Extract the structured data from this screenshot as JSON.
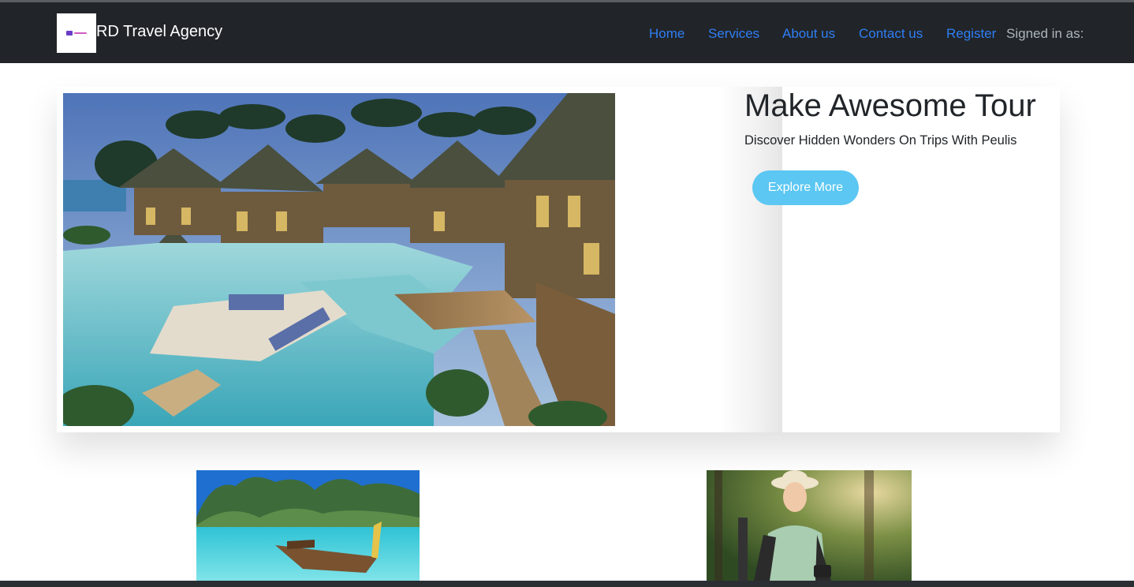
{
  "navbar": {
    "brand": "RD Travel Agency",
    "logo_icon": "brand-logo-icon",
    "links": [
      "Home",
      "Services",
      "About us",
      "Contact us",
      "Register"
    ],
    "signed_in": "Signed in as:",
    "link_color": "#2f7ef5",
    "background": "#212529"
  },
  "hero": {
    "title": "Make Awesome Tour",
    "subtitle": "Discover Hidden Wonders On Trips With Peulis",
    "button": "Explore More",
    "button_color": "#5bc7f2",
    "image": "resort-pool-villas-photo"
  },
  "cards": [
    {
      "image": "island-longtail-boat-photo"
    },
    {
      "image": "woman-hiker-camera-photo"
    }
  ]
}
